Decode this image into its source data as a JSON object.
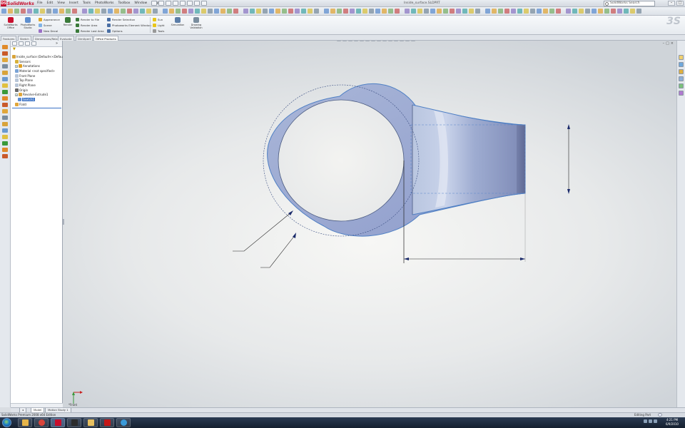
{
  "app": {
    "logo_text": "SolidWorks",
    "document_title": "Inside_surface.SLDPRT",
    "menus": [
      "File",
      "Edit",
      "View",
      "Insert",
      "Tools",
      "PhotoWorks",
      "Toolbox",
      "Window",
      "Help"
    ],
    "search_placeholder": "SolidWorks Search"
  },
  "ribbon": {
    "big_buttons": [
      {
        "label": "SolidWorks Office",
        "icon": "gear-icon"
      },
      {
        "label": "PhotoWorks Studio",
        "icon": "studio-icon"
      },
      {
        "label": "Render",
        "icon": "render-icon"
      },
      {
        "label": "Scenes Wizard",
        "icon": "wizard-icon"
      },
      {
        "label": "Simulation",
        "icon": "simulation-icon"
      },
      {
        "label": "Drawing Validation",
        "icon": "drawing-icon"
      }
    ],
    "small_buttons": [
      [
        "Appearance",
        "Scene",
        "New Decal"
      ],
      [
        "Render to File",
        "Render Area",
        "Render Last Area"
      ],
      [
        "Render Selection",
        "Photoworks Element Window",
        "Options"
      ],
      [
        "Sun",
        "Light",
        "Tools"
      ]
    ]
  },
  "command_tabs": [
    "Features",
    "Sketch",
    "Dimensions/Relations",
    "Evaluate",
    "DimXpert",
    "Office Products"
  ],
  "active_command_tab": "Office Products",
  "feature_tree": {
    "root": "Inside_surface (Default<<Default>_Di",
    "items": [
      {
        "label": "Sensors",
        "indent": 1,
        "icon": "sensor-icon",
        "expand": false
      },
      {
        "label": "Annotations",
        "indent": 1,
        "icon": "annotation-icon",
        "expand": true
      },
      {
        "label": "Material <not specified>",
        "indent": 1,
        "icon": "material-icon",
        "expand": false
      },
      {
        "label": "Front Plane",
        "indent": 1,
        "icon": "plane-icon",
        "expand": false
      },
      {
        "label": "Top Plane",
        "indent": 1,
        "icon": "plane-icon",
        "expand": false
      },
      {
        "label": "Right Plane",
        "indent": 1,
        "icon": "plane-icon",
        "expand": false
      },
      {
        "label": "Origin",
        "indent": 1,
        "icon": "origin-icon",
        "expand": false
      },
      {
        "label": "Revolve-Extrude1",
        "indent": 1,
        "icon": "feature-icon",
        "expand": true
      },
      {
        "label": "Sketch1",
        "indent": 2,
        "icon": "sketch-icon",
        "expand": false,
        "selected": true
      },
      {
        "label": "Flatd",
        "indent": 1,
        "icon": "feature-icon",
        "expand": false
      }
    ]
  },
  "sheet_tabs": [
    "Model",
    "Motion Study 1"
  ],
  "active_sheet_tab": "Model",
  "viewport": {
    "triad_label": "*Front"
  },
  "status": {
    "left": "SolidWorks Premium 2008 x64 Edition",
    "right": "Editing Part"
  },
  "clock": {
    "time": "4:21 PM",
    "date": "6/9/2010"
  },
  "taskbar_apps": [
    "windows-explorer-icon",
    "chrome-icon",
    "solidworks-icon",
    "x-icon",
    "folder-icon",
    "acrobat-icon",
    "media-player-icon",
    "network-icon"
  ]
}
